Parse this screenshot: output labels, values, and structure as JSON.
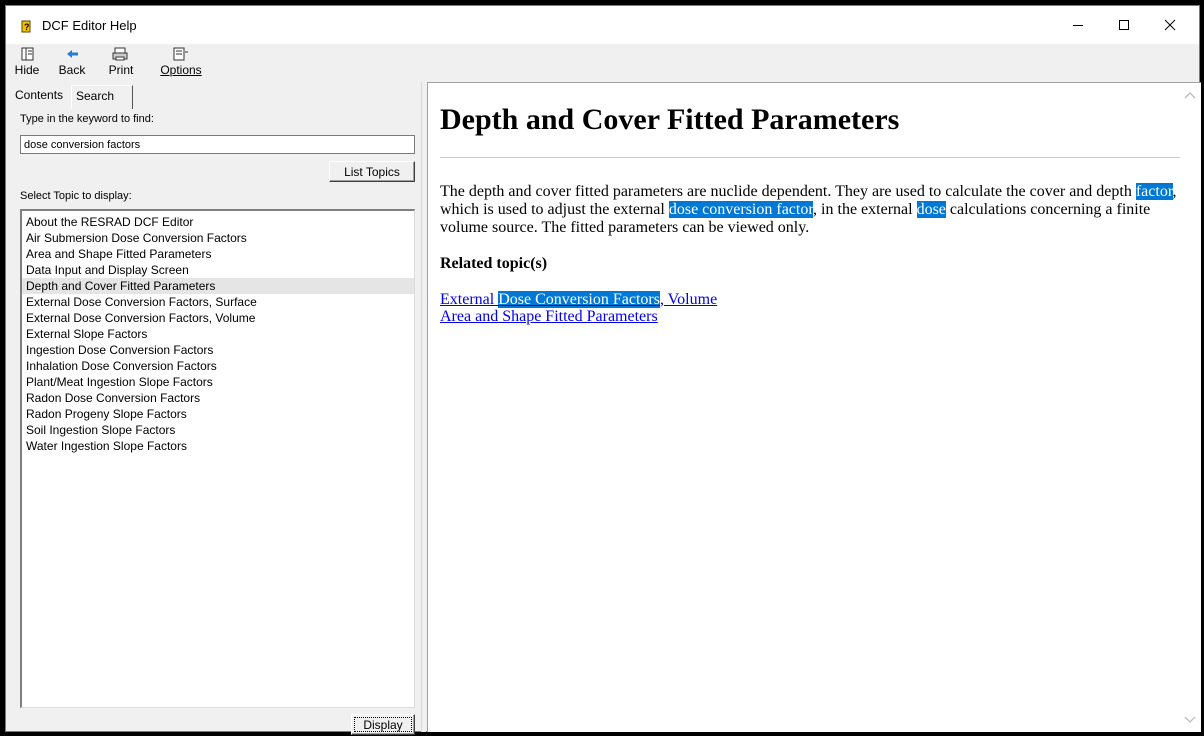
{
  "window": {
    "title": "DCF Editor Help"
  },
  "toolbar": {
    "hide": "Hide",
    "back": "Back",
    "print": "Print",
    "options": "Options"
  },
  "tabs": {
    "contents": "Contents",
    "search": "Search"
  },
  "search": {
    "keyword_label": "Type in the keyword to find:",
    "keyword_value": "dose conversion factors",
    "list_topics_label": "List Topics",
    "topic_label": "Select Topic to display:",
    "display_label": "Display"
  },
  "topics": [
    "About the RESRAD DCF Editor",
    "Air Submersion Dose Conversion Factors",
    "Area and Shape Fitted Parameters",
    "Data Input and Display Screen",
    "Depth and Cover Fitted Parameters",
    "External Dose Conversion Factors, Surface",
    "External Dose Conversion Factors, Volume",
    "External Slope Factors",
    "Ingestion Dose Conversion Factors",
    "Inhalation Dose Conversion Factors",
    "Plant/Meat Ingestion Slope Factors",
    "Radon Dose Conversion Factors",
    "Radon Progeny Slope Factors",
    "Soil Ingestion Slope Factors",
    "Water Ingestion Slope Factors"
  ],
  "selected_topic_index": 4,
  "article": {
    "title": "Depth and Cover Fitted Parameters",
    "p1": "The depth and cover fitted parameters are nuclide dependent. They are used to calculate the cover and depth ",
    "p1_hl1": "factor",
    "p1_b": ", which is used to adjust the external ",
    "p1_hl2": "dose conversion factor",
    "p1_c": ", in the external ",
    "p1_hl3": "dose",
    "p1_d": " calculations concerning a finite volume source. The fitted parameters can be viewed only.",
    "related_heading": "Related topic(s)",
    "link1_a": "External ",
    "link1_hl": "Dose Conversion Factors",
    "link1_b": ", Volume",
    "link2": "Area and Shape Fitted Parameters"
  },
  "colors": {
    "highlight": "#0078d7",
    "link": "#0000ee"
  }
}
